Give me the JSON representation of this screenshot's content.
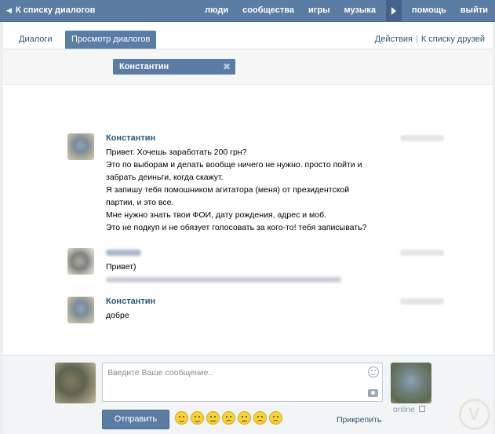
{
  "topbar": {
    "back_label": "К списку диалогов",
    "nav": [
      "люди",
      "сообщества",
      "игры",
      "музыка"
    ],
    "nav_right": [
      "помощь",
      "выйти"
    ]
  },
  "tabs": {
    "dialogs": "Диалоги",
    "view_dialogs": "Просмотр диалогов",
    "actions": "Действия",
    "to_friends": "К списку друзей"
  },
  "peer": {
    "name": "Константин",
    "remove_symbol": "✖"
  },
  "messages": [
    {
      "author": "Константин",
      "lines": [
        "Привет. Хочешь заработать 200 грн?",
        "Это по выборам и делать вообще ничего не нужно. просто пойти и",
        "забрать деиньги, когда скажут.",
        "Я запишу тебя помошником агитатора (меня) от президентской",
        "партии, и это все.",
        "Мне нужно знать твои ФОИ, дату рождения, адрес и моб.",
        "Это не подкуп и не обязует голосовать за кого-то! тебя записывать?"
      ]
    },
    {
      "author": "",
      "lines": [
        "Привет)"
      ]
    },
    {
      "author": "Константин",
      "lines": [
        "добре"
      ]
    }
  ],
  "composer": {
    "placeholder": "Введите Ваше сообщение..",
    "send_label": "Отправить",
    "attach_label": "Прикрепить",
    "online_label": "online"
  }
}
